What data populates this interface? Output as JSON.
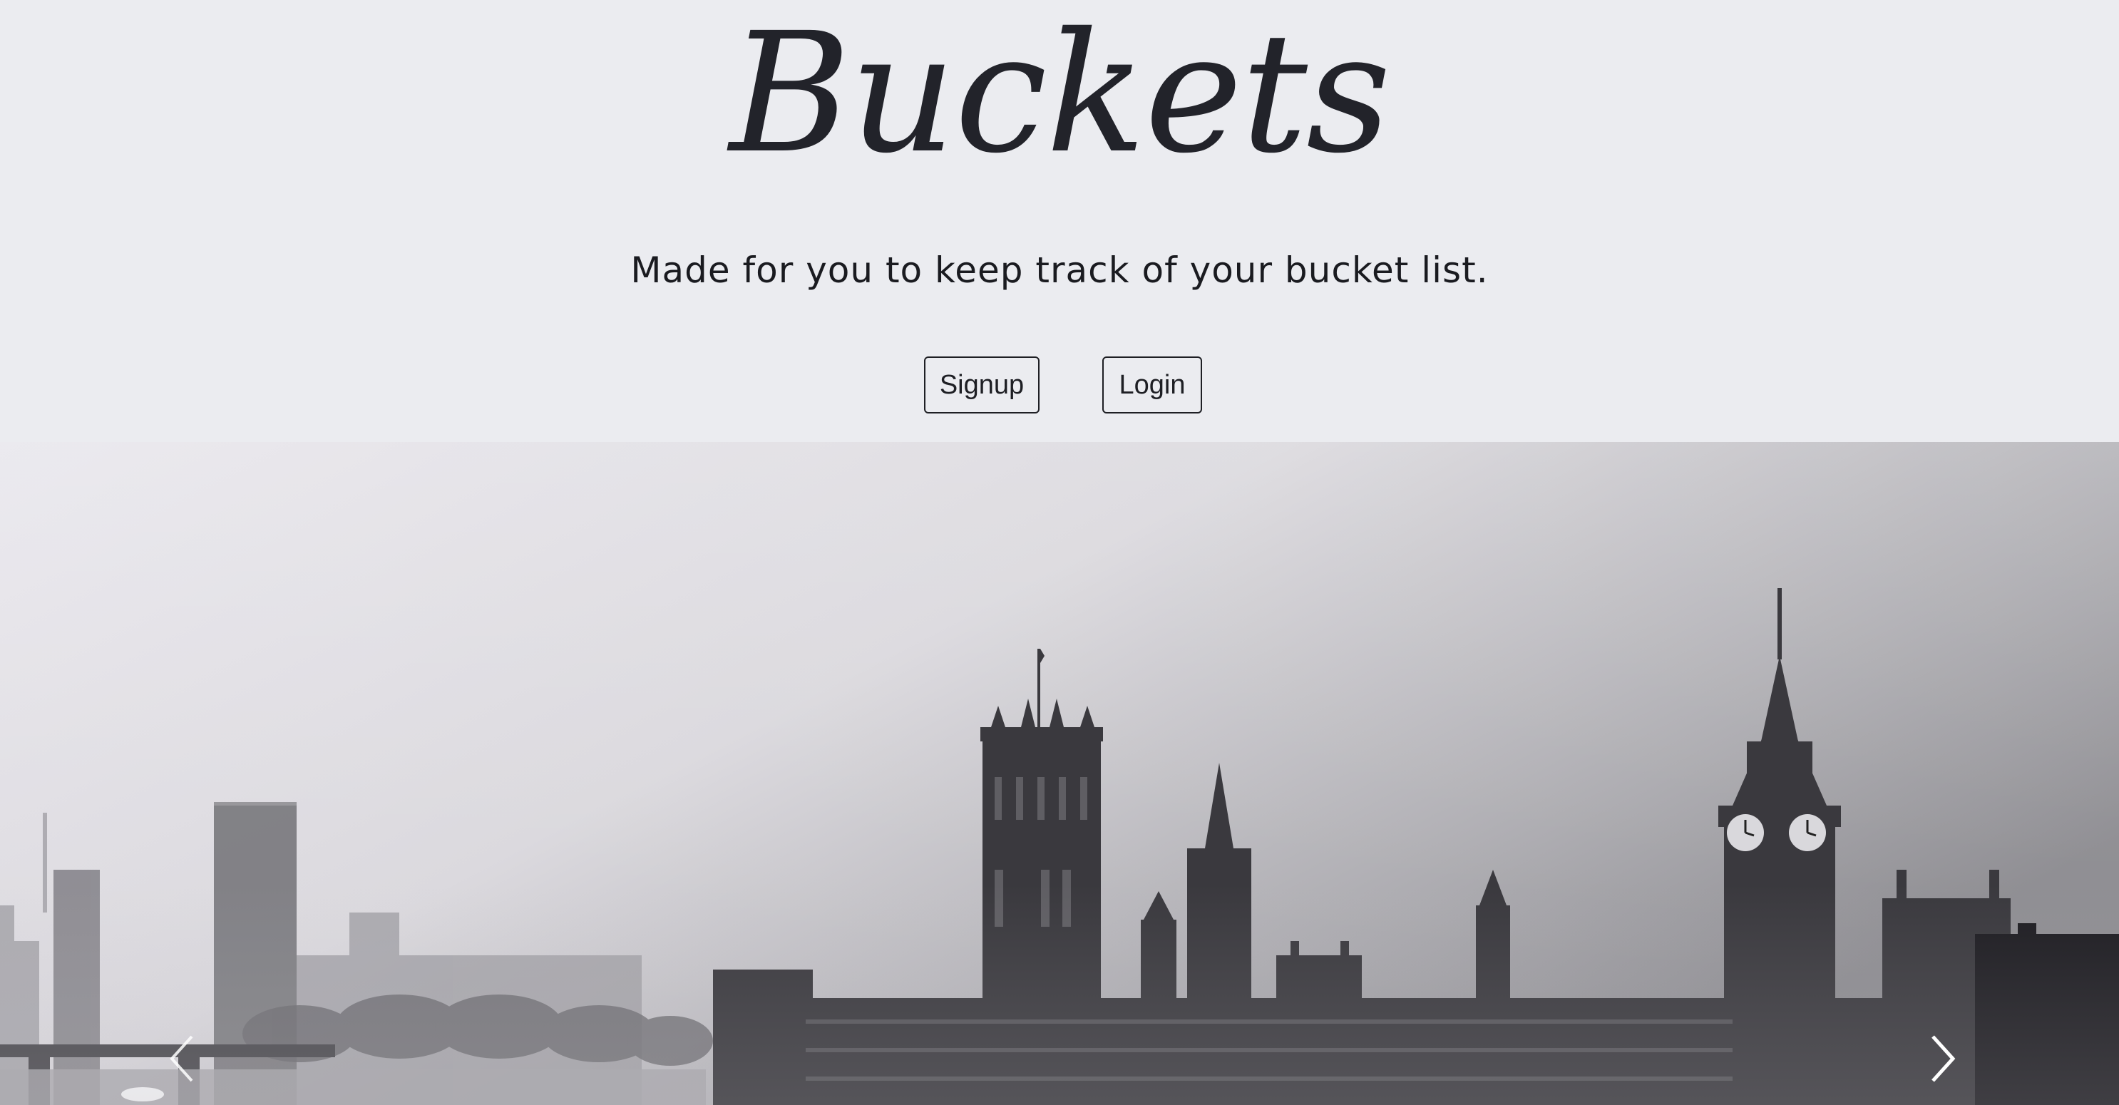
{
  "brand": {
    "title": "Buckets"
  },
  "hero": {
    "tagline": "Made for you to keep track of your bucket list."
  },
  "actions": {
    "signup_label": "Signup",
    "login_label": "Login"
  },
  "carousel": {
    "slide_description": "London skyline with Palace of Westminster and Big Ben in fog",
    "prev_icon": "chevron-left-icon",
    "next_icon": "chevron-right-icon"
  },
  "colors": {
    "background": "#ebecf0",
    "text": "#22232a",
    "button_border": "#1e1f24"
  }
}
